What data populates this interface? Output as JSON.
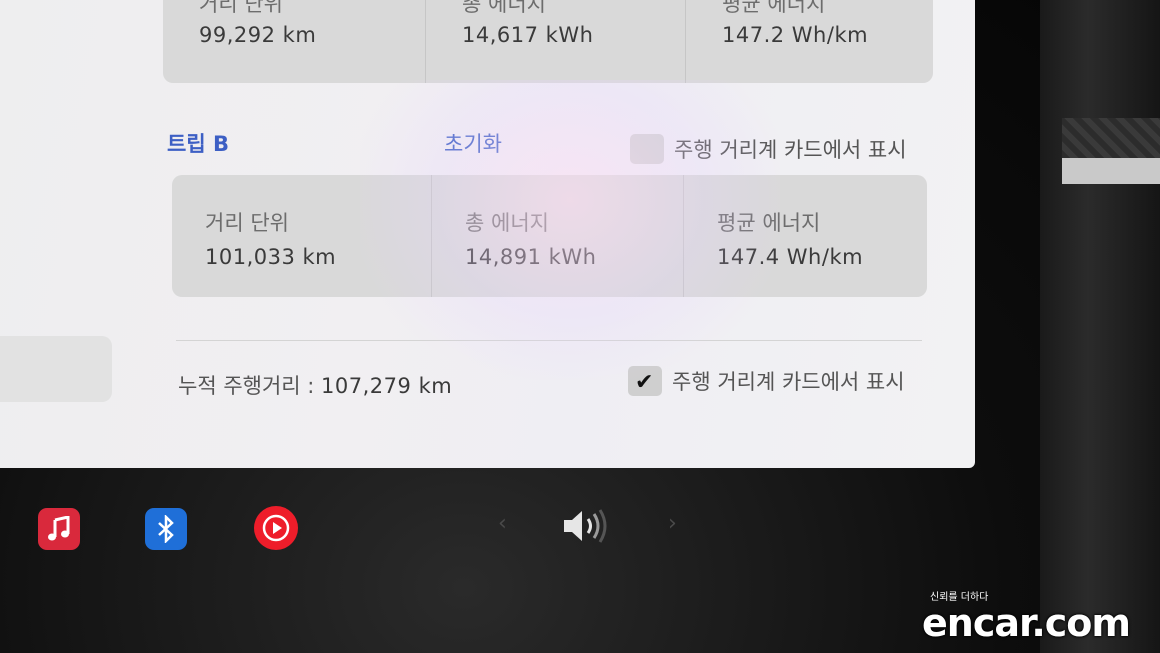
{
  "trip_a": {
    "distance_label": "거리 단위",
    "distance_value": "99,292 km",
    "energy_label": "총 에너지",
    "energy_value": "14,617 kWh",
    "avg_label": "평균 에너지",
    "avg_value": "147.2 Wh/km"
  },
  "trip_b": {
    "title": "트립 B",
    "reset_label": "초기화",
    "show_card_label": "주행 거리계 카드에서 표시",
    "show_card_checked": false,
    "distance_label": "거리 단위",
    "distance_value": "101,033 km",
    "energy_label": "총 에너지",
    "energy_value": "14,891 kWh",
    "avg_label": "평균 에너지",
    "avg_value": "147.4 Wh/km"
  },
  "odometer": {
    "label": "누적 주행거리 :",
    "value": "107,279 km",
    "show_card_label": "주행 거리계 카드에서 표시",
    "show_card_checked": true
  },
  "taskbar": {
    "apps": [
      "music-icon",
      "bluetooth-icon",
      "media-player-icon"
    ],
    "prev_arrow": "‹",
    "next_arrow": "›",
    "volume_icon": "volume-icon"
  },
  "watermark": {
    "tagline": "신뢰를 더하다",
    "brand": "encar.com"
  },
  "colors": {
    "accent": "#3d5fc4",
    "music": "#d9293c",
    "bluetooth": "#1f6fd8",
    "media": "#ee1d2a"
  }
}
